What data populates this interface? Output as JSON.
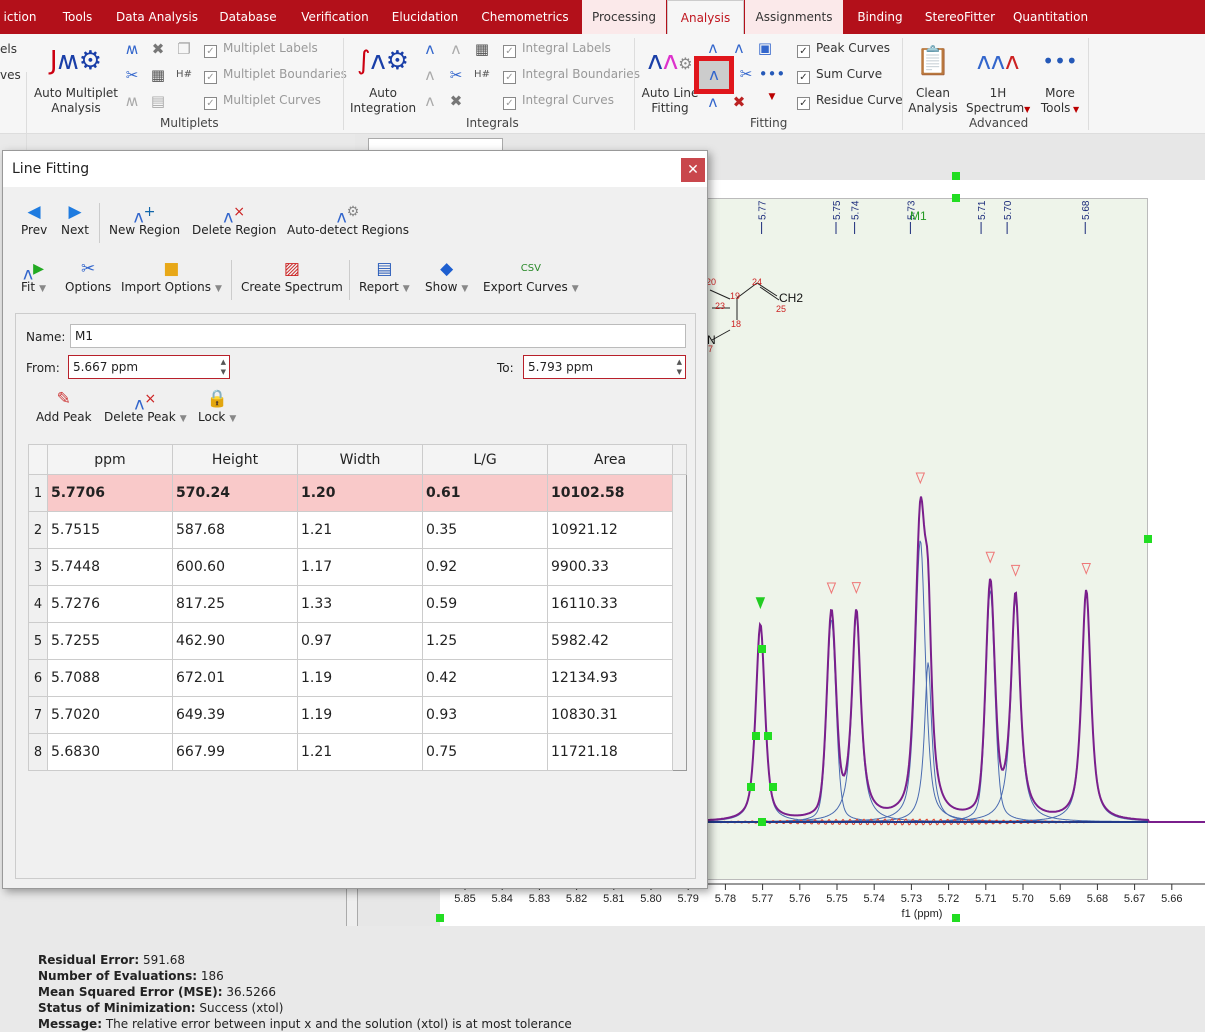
{
  "tabs": [
    {
      "label": "iction"
    },
    {
      "label": "Tools"
    },
    {
      "label": "Data Analysis"
    },
    {
      "label": "Database"
    },
    {
      "label": "Verification"
    },
    {
      "label": "Elucidation"
    },
    {
      "label": "Chemometrics"
    },
    {
      "label": "Processing"
    },
    {
      "label": "Analysis"
    },
    {
      "label": "Assignments"
    },
    {
      "label": "Binding"
    },
    {
      "label": "StereoFitter"
    },
    {
      "label": "Quantitation"
    }
  ],
  "ribbon": {
    "left_cut": [
      "els",
      "ves"
    ],
    "auto_multiplet": "Auto Multiplet Analysis",
    "multiplet_checks": [
      "Multiplet Labels",
      "Multiplet Boundaries",
      "Multiplet Curves"
    ],
    "multiplets_group": "Multiplets",
    "auto_integration": "Auto Integration",
    "integral_checks": [
      "Integral Labels",
      "Integral Boundaries",
      "Integral Curves"
    ],
    "integrals_group": "Integrals",
    "auto_line_fitting": "Auto Line Fitting",
    "fitting_checks": [
      "Peak Curves",
      "Sum Curve",
      "Residue Curve"
    ],
    "fitting_group": "Fitting",
    "clean_analysis": "Clean Analysis",
    "spectrum_1h": "1H Spectrum",
    "more_tools": "More Tools",
    "advanced_group": "Advanced"
  },
  "dialog": {
    "title": "Line Fitting",
    "toolbar1": [
      "Prev",
      "Next",
      "New Region",
      "Delete Region",
      "Auto-detect Regions"
    ],
    "toolbar2": [
      "Fit",
      "Options",
      "Import Options",
      "Create Spectrum",
      "Report",
      "Show",
      "Export Curves"
    ],
    "name_label": "Name:",
    "name_value": "M1",
    "from_label": "From:",
    "from_value": "5.667 ppm",
    "to_label": "To:",
    "to_value": "5.793 ppm",
    "peak_tools": [
      "Add Peak",
      "Delete Peak",
      "Lock"
    ],
    "columns": [
      "ppm",
      "Height",
      "Width",
      "L/G",
      "Area"
    ],
    "rows": [
      [
        "1",
        "5.7706",
        "570.24",
        "1.20",
        "0.61",
        "10102.58"
      ],
      [
        "2",
        "5.7515",
        "587.68",
        "1.21",
        "0.35",
        "10921.12"
      ],
      [
        "3",
        "5.7448",
        "600.60",
        "1.17",
        "0.92",
        "9900.33"
      ],
      [
        "4",
        "5.7276",
        "817.25",
        "1.33",
        "0.59",
        "16110.33"
      ],
      [
        "5",
        "5.7255",
        "462.90",
        "0.97",
        "1.25",
        "5982.42"
      ],
      [
        "6",
        "5.7088",
        "672.01",
        "1.19",
        "0.42",
        "12134.93"
      ],
      [
        "7",
        "5.7020",
        "649.39",
        "1.19",
        "0.93",
        "10830.31"
      ],
      [
        "8",
        "5.6830",
        "667.99",
        "1.21",
        "0.75",
        "11721.18"
      ]
    ],
    "selected_row": 1,
    "stats": [
      {
        "k": "Residual Error:",
        "v": "591.68"
      },
      {
        "k": "Number of Evaluations:",
        "v": "186"
      },
      {
        "k": "Mean Squared Error (MSE):",
        "v": "36.5266"
      },
      {
        "k": "Status of Minimization:",
        "v": "Success (xtol)"
      },
      {
        "k": "Message:",
        "v": "The relative error between input x and the solution (xtol) is at most tolerance"
      }
    ]
  },
  "spectrum": {
    "peak_labels": [
      "5.77",
      "5.75",
      "5.74",
      "5.73",
      "5.71",
      "5.70",
      "5.68"
    ],
    "multiplet_label": "M1",
    "axis_ticks": [
      "5.85",
      "5.84",
      "5.83",
      "5.82",
      "5.81",
      "5.80",
      "5.79",
      "5.78",
      "5.77",
      "5.76",
      "5.75",
      "5.74",
      "5.73",
      "5.72",
      "5.71",
      "5.70",
      "5.69",
      "5.68",
      "5.67",
      "5.66",
      "5"
    ],
    "axis_label": "f1 (ppm)",
    "atoms": [
      "20",
      "19",
      "24",
      "23",
      "18",
      "25",
      "7"
    ],
    "ch2": "CH2",
    "n": "N",
    "colors": {
      "sum": "#7a1f8c",
      "peaks": "#4a6bb0",
      "residue": "#e0412a",
      "handle": "#22dd22",
      "region": "#eef4ea"
    }
  }
}
